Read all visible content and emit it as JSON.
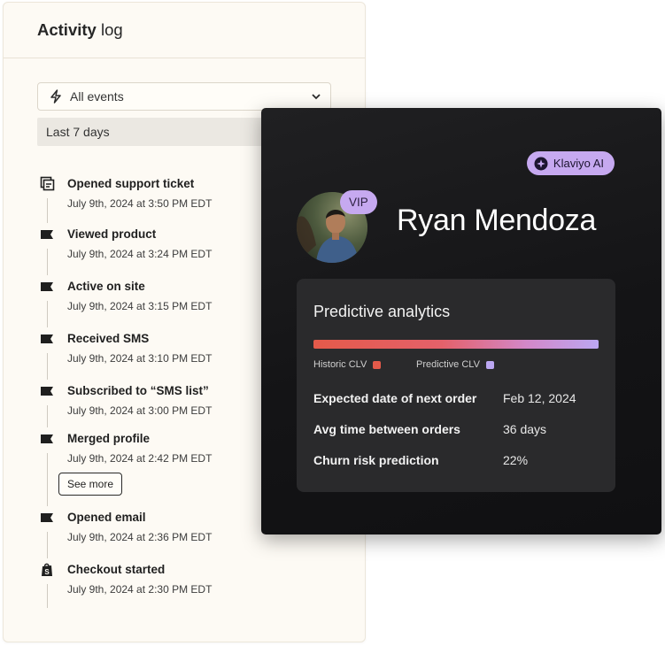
{
  "activity_log": {
    "title_bold": "Activity",
    "title_rest": " log",
    "filter": {
      "icon": "bolt-icon",
      "value": "All events",
      "chevron": "chevron-down-icon"
    },
    "date_range": "Last 7 days",
    "see_more_label": "See more",
    "events": [
      {
        "icon": "support-ticket-icon",
        "title": "Opened support ticket",
        "time": "July 9th, 2024 at 3:50 PM EDT"
      },
      {
        "icon": "flag-icon",
        "title": "Viewed product",
        "time": "July 9th, 2024 at 3:24 PM EDT"
      },
      {
        "icon": "flag-icon",
        "title": "Active on site",
        "time": "July 9th, 2024 at 3:15 PM EDT"
      },
      {
        "icon": "flag-icon",
        "title": "Received SMS",
        "time": "July 9th, 2024 at 3:10 PM EDT"
      },
      {
        "icon": "flag-icon",
        "title": "Subscribed to “SMS list”",
        "time": "July 9th, 2024 at 3:00 PM EDT"
      },
      {
        "icon": "flag-icon",
        "title": "Merged profile",
        "time": "July 9th, 2024 at 2:42 PM EDT"
      },
      {
        "icon": "flag-icon",
        "title": "Opened email",
        "time": "July 9th, 2024 at 2:36 PM EDT"
      },
      {
        "icon": "shopify-bag-icon",
        "title": "Checkout started",
        "time": "July 9th, 2024 at 2:30 PM EDT"
      }
    ]
  },
  "profile": {
    "ai_badge": "Klaviyo AI",
    "vip_badge": "VIP",
    "name": "Ryan Mendoza",
    "analytics": {
      "title": "Predictive analytics",
      "legend_historic": "Historic CLV",
      "legend_predictive": "Predictive CLV",
      "historic_color": "#e45a4a",
      "predictive_color": "#bba7f2",
      "metrics": [
        {
          "label": "Expected date of next order",
          "value": "Feb 12, 2024"
        },
        {
          "label": "Avg time between orders",
          "value": "36 days"
        },
        {
          "label": "Churn risk prediction",
          "value": "22%"
        }
      ]
    }
  }
}
